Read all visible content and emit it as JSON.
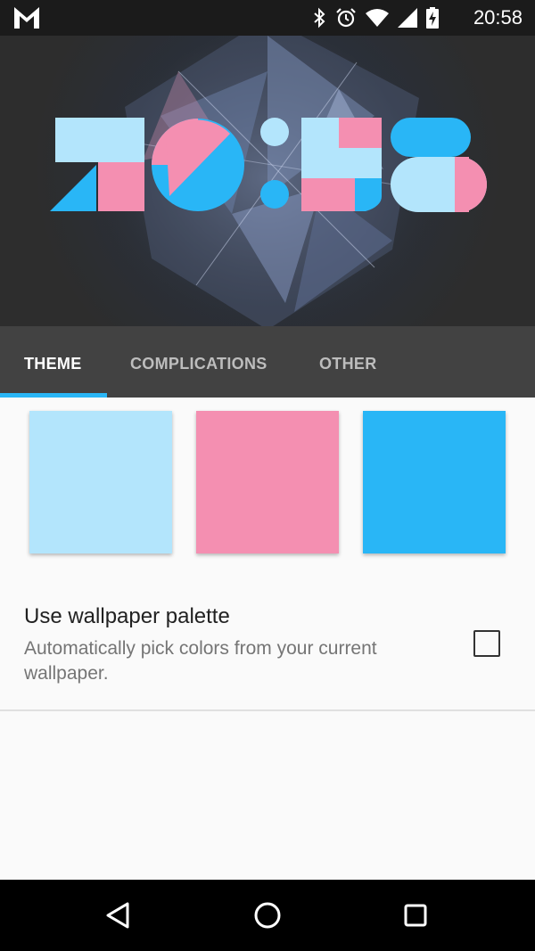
{
  "status_bar": {
    "time": "20:58",
    "icons": [
      "gmail-icon",
      "bluetooth-icon",
      "alarm-icon",
      "wifi-icon",
      "cell-signal-icon",
      "battery-charging-icon"
    ]
  },
  "preview": {
    "watchface_time": "20:58"
  },
  "tabs": [
    {
      "label": "THEME",
      "active": true
    },
    {
      "label": "COMPLICATIONS",
      "active": false
    },
    {
      "label": "OTHER",
      "active": false
    }
  ],
  "theme": {
    "swatches": [
      {
        "name": "light-blue",
        "color": "#b3e5fc"
      },
      {
        "name": "pink",
        "color": "#f48fb1"
      },
      {
        "name": "blue",
        "color": "#29b6f6"
      }
    ],
    "wallpaper_palette": {
      "title": "Use wallpaper palette",
      "summary": "Automatically pick colors from your current wallpaper.",
      "checked": false
    }
  },
  "nav_bar": {
    "buttons": [
      "back-icon",
      "home-icon",
      "recents-icon"
    ]
  },
  "colors": {
    "accent": "#29b6f6",
    "tab_bar": "#424242",
    "status_bar": "#1b1b1b"
  }
}
